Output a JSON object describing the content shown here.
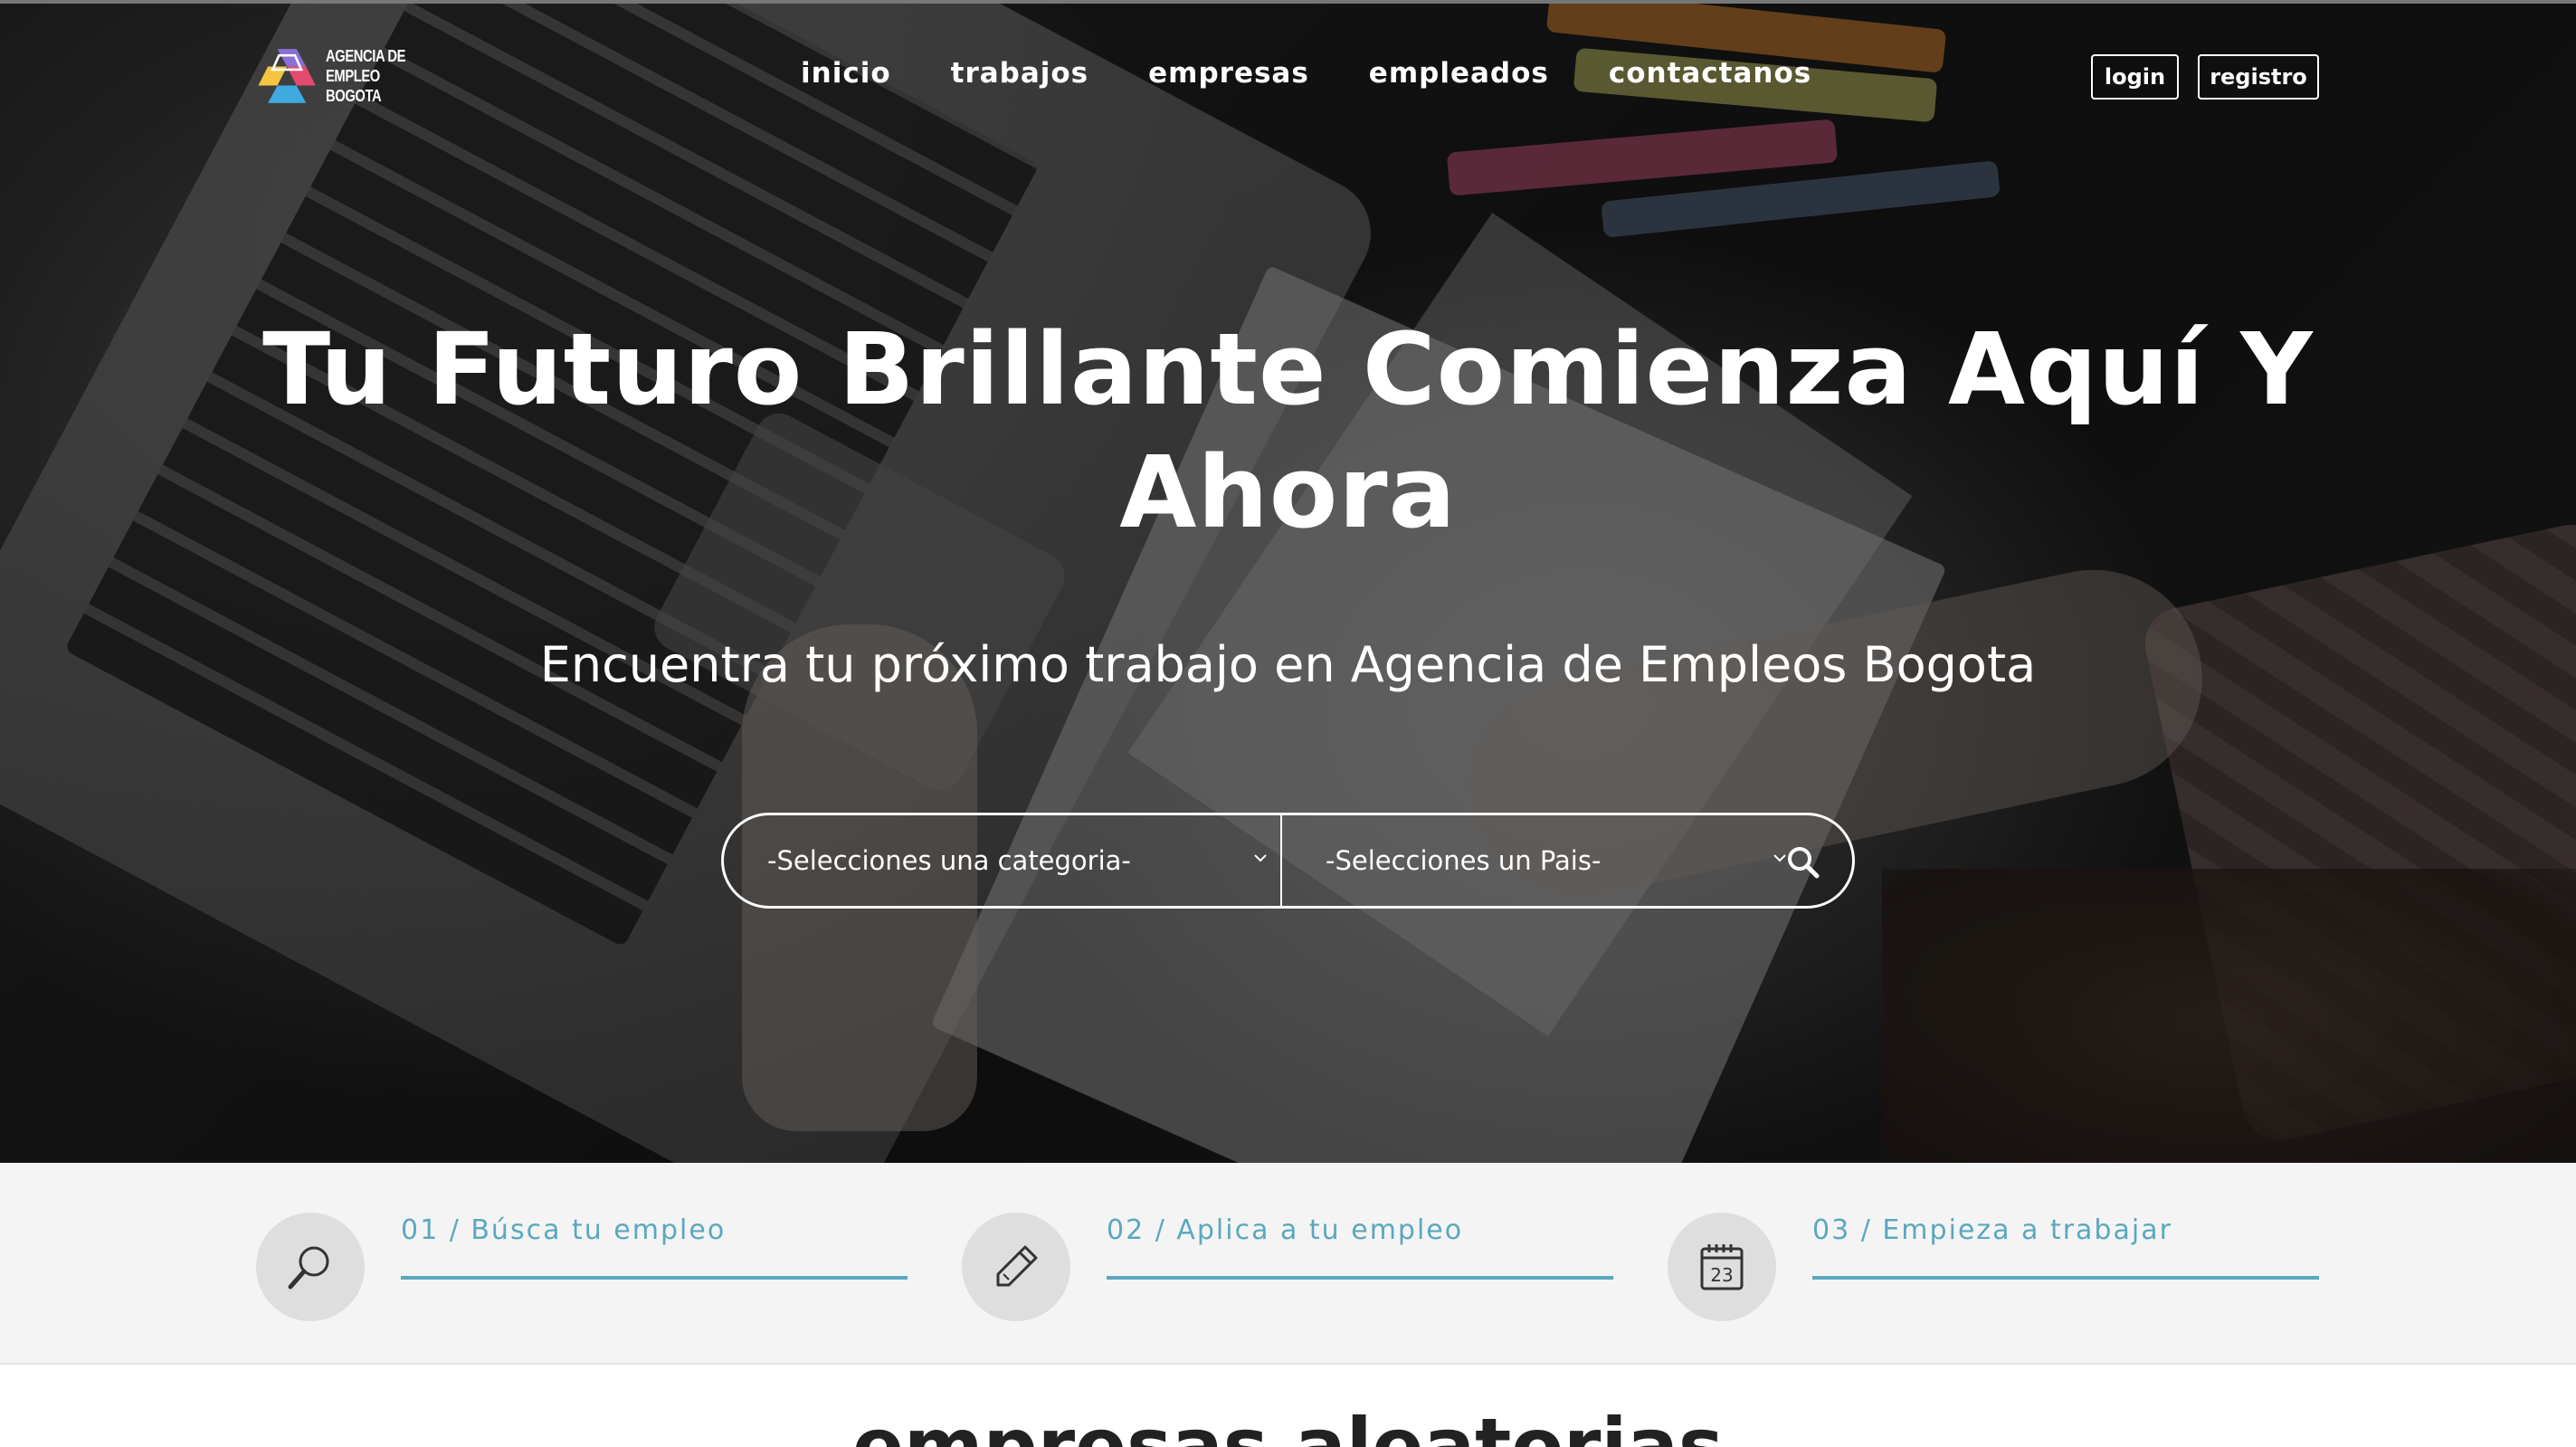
{
  "brand": {
    "logo_line1": "AGENCIA DE",
    "logo_line2": "EMPLEO BOGOTA"
  },
  "nav": {
    "items": [
      {
        "label": "inicio"
      },
      {
        "label": "trabajos"
      },
      {
        "label": "empresas"
      },
      {
        "label": "empleados"
      },
      {
        "label": "contactanos"
      }
    ],
    "login_label": "login",
    "registro_label": "registro"
  },
  "hero": {
    "headline_line1": "Tu Futuro Brillante Comienza Aquí Y",
    "headline_line2": "Ahora",
    "subheadline": "Encuentra tu próximo trabajo en Agencia de Empleos Bogota"
  },
  "search": {
    "category_selected": "-Selecciones una categoria-",
    "country_selected": "-Selecciones un Pais-",
    "button_icon": "search-icon"
  },
  "steps": [
    {
      "label": "01 / Búsca tu empleo",
      "icon": "magnifier-icon"
    },
    {
      "label": "02 / Aplica a tu empleo",
      "icon": "pencil-icon"
    },
    {
      "label": "03 / Empieza a trabajar",
      "icon": "calendar-icon",
      "icon_text": "23"
    }
  ],
  "sections": {
    "random_companies_title": "empresas aleatorias"
  },
  "colors": {
    "accent": "#5aa8bf",
    "band_bg": "#f4f4f4",
    "hero_overlay": "#000000"
  }
}
